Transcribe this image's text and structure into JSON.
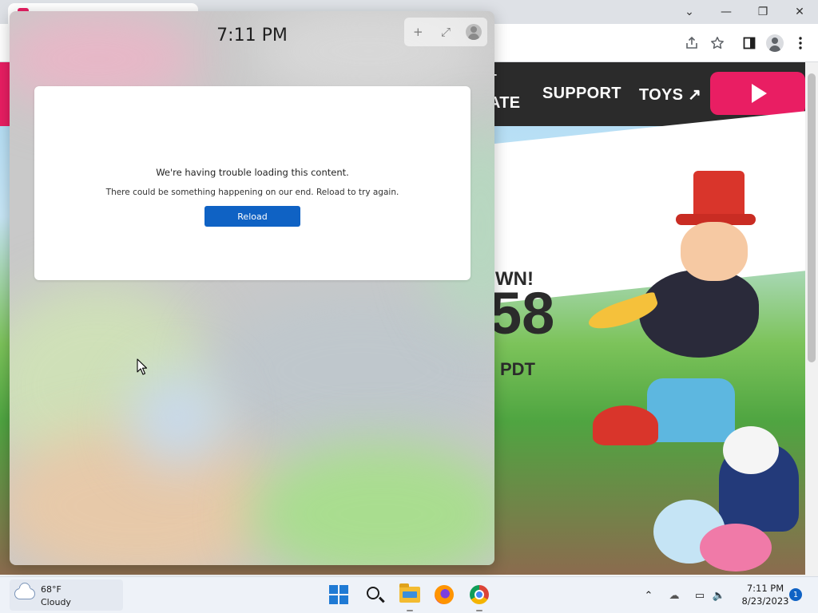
{
  "window_controls": {
    "dropdown": "⌄",
    "minimize": "—",
    "restore": "❐",
    "close": "✕"
  },
  "site": {
    "nav_partial_1": "T",
    "nav_partial_2": "ATE",
    "nav_support": "SUPPORT",
    "nav_toys": "TOYS ↗",
    "banner_partial": "WN!",
    "countdown_partial": "58",
    "timezone_partial": "PDT",
    "accent_color": "#e91e63"
  },
  "widgets": {
    "time": "7:11 PM",
    "controls": {
      "add": "+",
      "expand": "⤢"
    },
    "error": {
      "title": "We're having trouble loading this content.",
      "subtitle": "There could be something happening on our end. Reload to try again.",
      "reload_label": "Reload"
    }
  },
  "taskbar": {
    "weather": {
      "temp": "68°F",
      "desc": "Cloudy"
    },
    "apps": [
      {
        "name": "start",
        "icon": "windows-icon"
      },
      {
        "name": "search",
        "icon": "search-icon"
      },
      {
        "name": "file-explorer",
        "icon": "folder-icon",
        "active": true
      },
      {
        "name": "firefox",
        "icon": "firefox-icon"
      },
      {
        "name": "chrome",
        "icon": "chrome-icon",
        "active": true
      }
    ],
    "tray": {
      "chevron": "⌃",
      "onedrive": "☁",
      "network": "▭",
      "volume": "🔈"
    },
    "clock": {
      "time": "7:11 PM",
      "date": "8/23/2023"
    },
    "notification_count": "1"
  }
}
